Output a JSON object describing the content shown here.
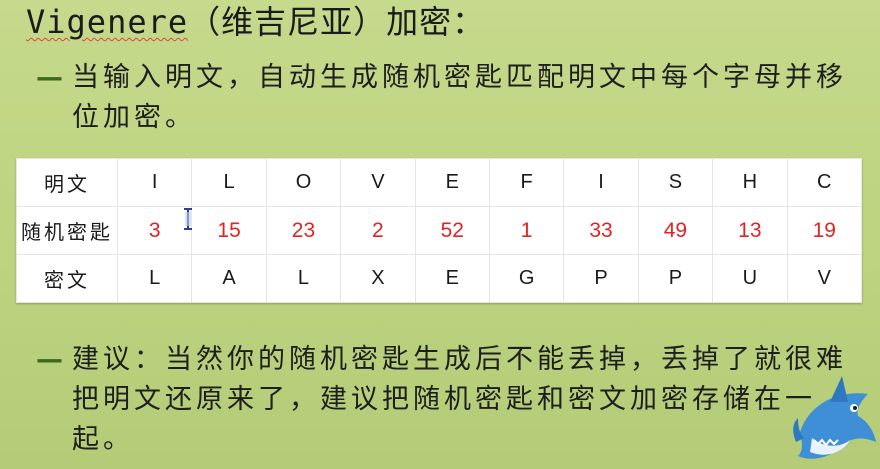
{
  "title": {
    "latin": "Vigenere",
    "rest": "（维吉尼亚）加密："
  },
  "bullets": [
    {
      "marker": "—",
      "text": "当输入明文，自动生成随机密匙匹配明文中每个字母并移位加密。"
    },
    {
      "marker": "—",
      "text": "建议：当然你的随机密匙生成后不能丢掉，丢掉了就很难把明文还原来了，建议把随机密匙和密文加密存储在一起。"
    }
  ],
  "table": {
    "rows": [
      {
        "label": "明文",
        "cells": [
          "I",
          "L",
          "O",
          "V",
          "E",
          "F",
          "I",
          "S",
          "H",
          "C"
        ]
      },
      {
        "label": "随机密匙",
        "cells": [
          "3",
          "15",
          "23",
          "2",
          "52",
          "1",
          "33",
          "49",
          "13",
          "19"
        ]
      },
      {
        "label": "密文",
        "cells": [
          "L",
          "A",
          "L",
          "X",
          "E",
          "G",
          "P",
          "P",
          "U",
          "V"
        ]
      }
    ]
  },
  "colors": {
    "background": "#c0d584",
    "key_text": "#e52222",
    "bullet_marker": "#3b6a1a"
  },
  "icons": [
    "text-cursor-icon",
    "shark-mascot-icon"
  ]
}
